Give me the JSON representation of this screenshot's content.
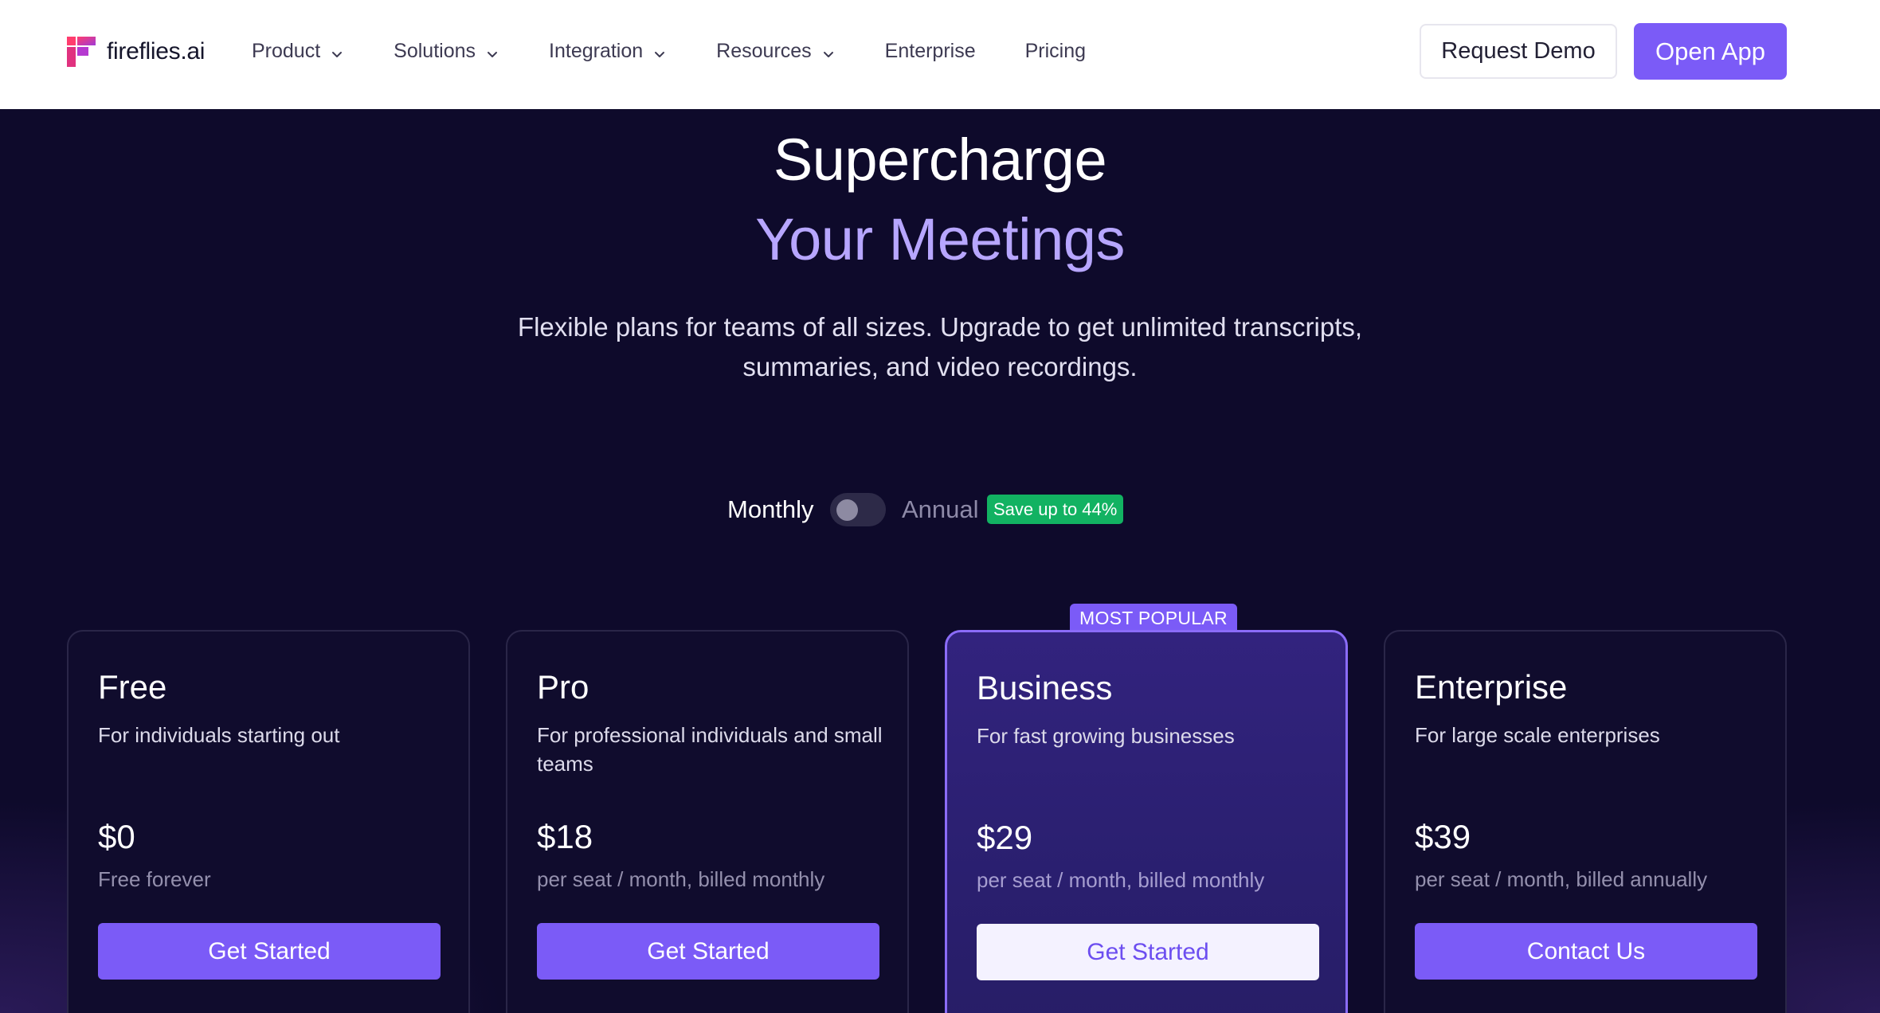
{
  "brand": {
    "name": "fireflies.ai"
  },
  "nav": {
    "items": [
      {
        "label": "Product",
        "dropdown": true
      },
      {
        "label": "Solutions",
        "dropdown": true
      },
      {
        "label": "Integration",
        "dropdown": true
      },
      {
        "label": "Resources",
        "dropdown": true
      },
      {
        "label": "Enterprise",
        "dropdown": false
      },
      {
        "label": "Pricing",
        "dropdown": false
      }
    ],
    "request_demo": "Request Demo",
    "open_app": "Open App"
  },
  "hero": {
    "line1": "Supercharge",
    "line2": "Your Meetings",
    "subtitle": "Flexible plans for teams of all sizes. Upgrade to get unlimited transcripts, summaries, and video recordings."
  },
  "billing": {
    "monthly_label": "Monthly",
    "annual_label": "Annual",
    "save_badge": "Save up to 44%",
    "annual_selected": false
  },
  "plans": [
    {
      "name": "Free",
      "description": "For individuals starting out",
      "price": "$0",
      "price_note": "Free forever",
      "cta": "Get Started"
    },
    {
      "name": "Pro",
      "description": "For professional individuals and small teams",
      "price": "$18",
      "price_note": "per seat / month, billed monthly",
      "cta": "Get Started"
    },
    {
      "name": "Business",
      "description": "For fast growing businesses",
      "price": "$29",
      "price_note": "per seat / month, billed monthly",
      "cta": "Get Started",
      "tag": "MOST POPULAR"
    },
    {
      "name": "Enterprise",
      "description": "For large scale enterprises",
      "price": "$39",
      "price_note": "per seat / month, billed annually",
      "cta": "Contact Us"
    }
  ],
  "colors": {
    "accent": "#7b5bf7",
    "hero_highlight": "#b7a6ff",
    "background": "#0e0a2b",
    "save_badge": "#12b262"
  },
  "icons": {
    "logo": "fireflies-logo-icon",
    "dropdown": "chevron-down-icon"
  }
}
